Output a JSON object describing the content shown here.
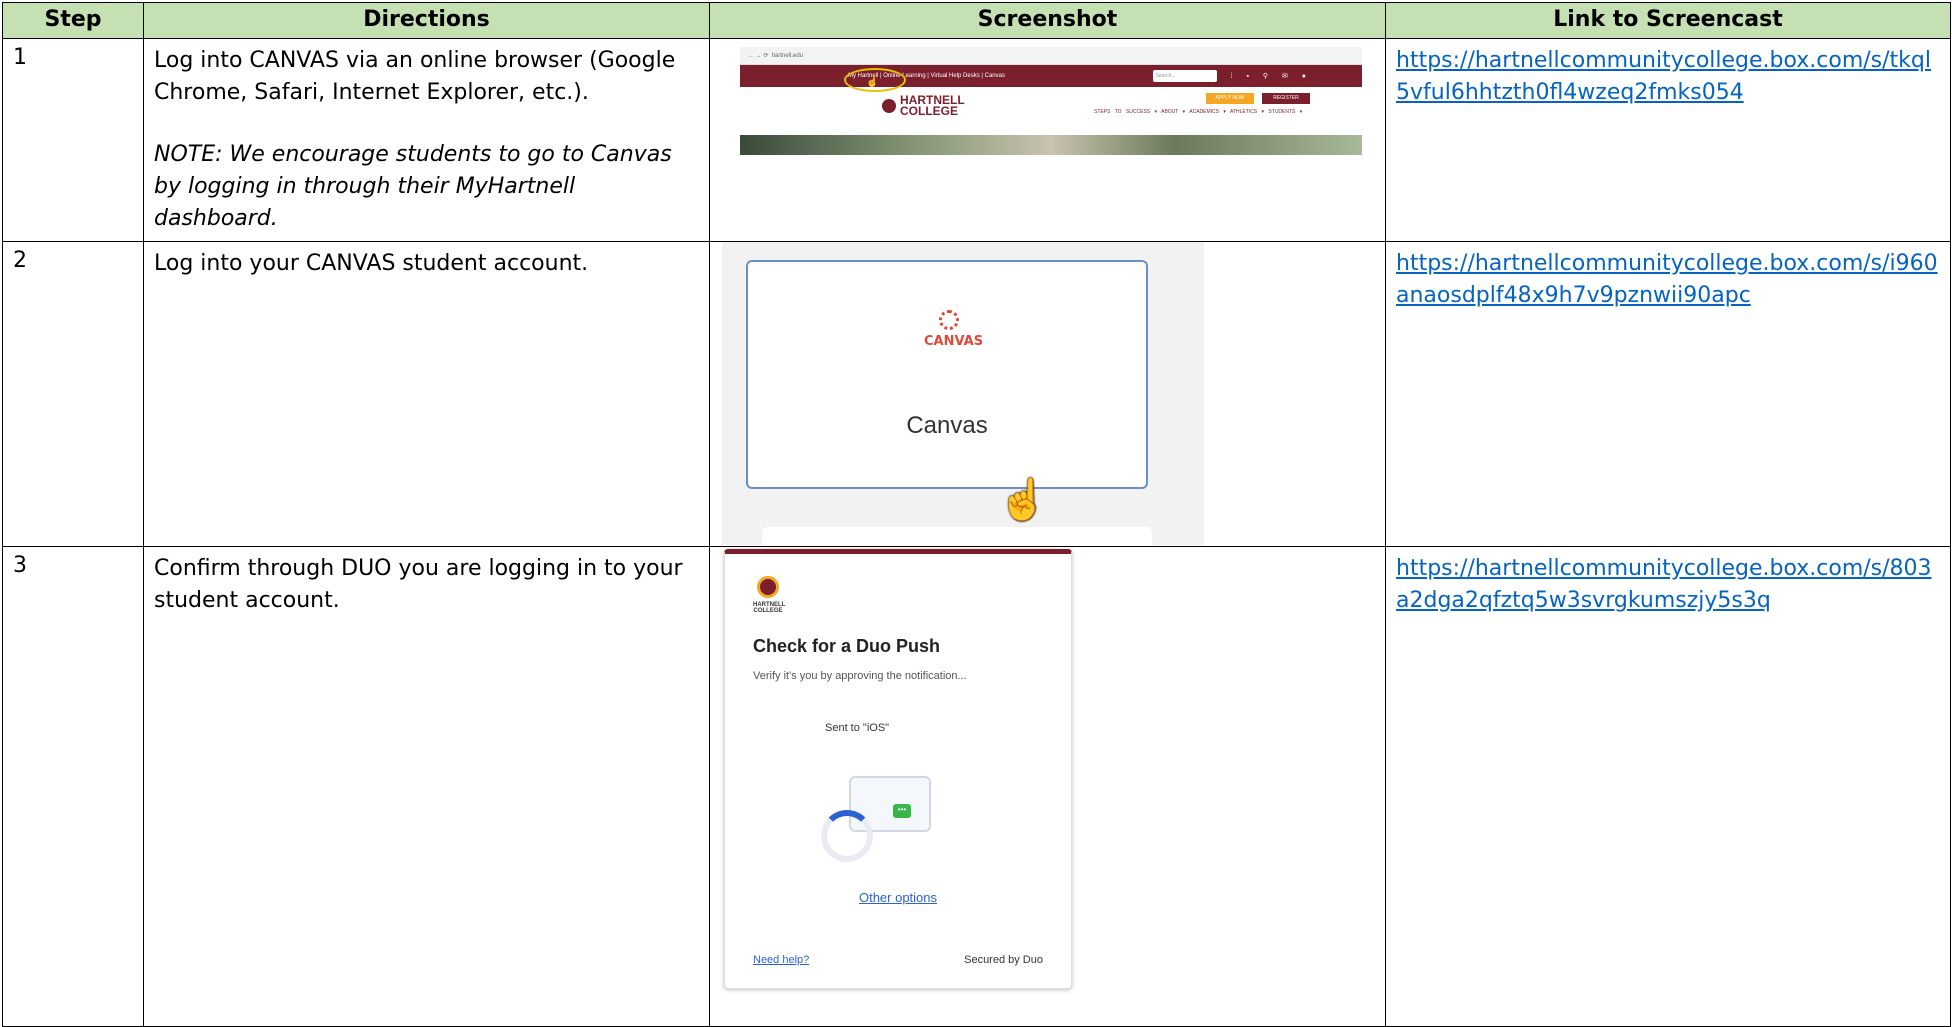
{
  "table": {
    "headers": [
      "Step",
      "Directions",
      "Screenshot",
      "Link to Screencast"
    ],
    "rows": [
      {
        "step": "1",
        "direction": "Log into CANVAS via an online browser (Google Chrome, Safari, Internet Explorer, etc.).",
        "note": "NOTE: We encourage students to go to Canvas by logging in through their MyHartnell dashboard.",
        "link": "https://hartnellcommunitycollege.box.com/s/tkql5vful6hhtzth0fl4wzeq2fmks054"
      },
      {
        "step": "2",
        "direction": "Log into your CANVAS student account.",
        "link": "https://hartnellcommunitycollege.box.com/s/i960anaosdplf48x9h7v9pznwii90apc"
      },
      {
        "step": "3",
        "direction": "Confirm through DUO you are logging in to your student account.",
        "link": "https://hartnellcommunitycollege.box.com/s/803a2dga2qfztq5w3svrgkumszjy5s3q"
      }
    ]
  },
  "shot1": {
    "url": "hartnell.edu",
    "topbar": "My Hartnell | Online Learning | Virtual Help Desks | Canvas",
    "search": "Search...",
    "logo": "HARTNELL COLLEGE",
    "apply": "APPLY NOW",
    "register": "REGISTER",
    "nav": "STEPS TO SUCCESS ▾  ABOUT ▾  ACADEMICS ▾  ATHLETICS ▾  STUDENTS ▾"
  },
  "shot2": {
    "logo_text": "CANVAS",
    "card_label": "Canvas"
  },
  "shot3": {
    "logo_text": "HARTNELL COLLEGE",
    "title": "Check for a Duo Push",
    "subtitle": "Verify it's you by approving the notification...",
    "sent": "Sent to \"iOS\"",
    "other_options": "Other options",
    "need_help": "Need help?",
    "secured": "Secured by Duo"
  }
}
